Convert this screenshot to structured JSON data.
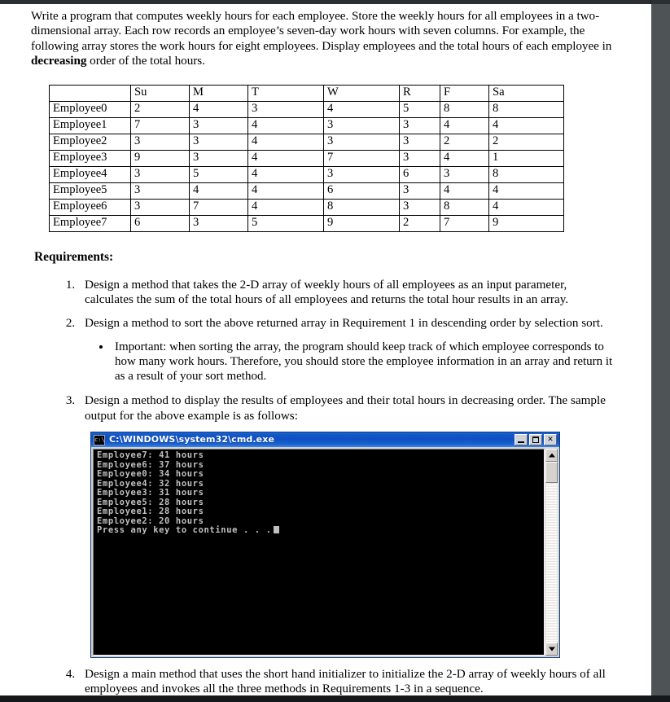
{
  "document": {
    "intro_paragraph": "Write a program that computes weekly hours for each employee.  Store the weekly hours for all employees in a two-dimensional array.  Each row records an employee’s seven-day work hours with seven columns.  For example, the following array stores the work hours for eight employees.  Display employees and the total hours of each employee in ",
    "intro_bold": "decreasing",
    "intro_tail": " order of the total hours.",
    "requirements_heading": "Requirements:"
  },
  "hours_table": {
    "corner_label": "",
    "columns": [
      "Su",
      "M",
      "T",
      "W",
      "R",
      "F",
      "Sa"
    ],
    "rows": [
      {
        "label": "Employee0",
        "values": [
          2,
          4,
          3,
          4,
          5,
          8,
          8
        ]
      },
      {
        "label": "Employee1",
        "values": [
          7,
          3,
          4,
          3,
          3,
          4,
          4
        ]
      },
      {
        "label": "Employee2",
        "values": [
          3,
          3,
          4,
          3,
          3,
          2,
          2
        ]
      },
      {
        "label": "Employee3",
        "values": [
          9,
          3,
          4,
          7,
          3,
          4,
          1
        ]
      },
      {
        "label": "Employee4",
        "values": [
          3,
          5,
          4,
          3,
          6,
          3,
          8
        ]
      },
      {
        "label": "Employee5",
        "values": [
          3,
          4,
          4,
          6,
          3,
          4,
          4
        ]
      },
      {
        "label": "Employee6",
        "values": [
          3,
          7,
          4,
          8,
          3,
          8,
          4
        ]
      },
      {
        "label": "Employee7",
        "values": [
          6,
          3,
          5,
          9,
          2,
          7,
          9
        ]
      }
    ]
  },
  "requirements": [
    {
      "text": "Design a method that takes the 2-D array of weekly hours of all employees as an input parameter, calculates the sum of the total hours of all employees and returns the total hour results in an array."
    },
    {
      "text": "Design a method to sort the above returned array in Requirement 1 in descending order by selection sort.",
      "sub_bullets": [
        "Important: when sorting the array, the program should keep track of which employee corresponds to how many work hours. Therefore, you should store the employee information in an array and return it as a result of your sort method."
      ]
    },
    {
      "text": "Design a method to display the results of employees and their total hours in decreasing order.  The sample output for the above example is as follows:"
    },
    {
      "text": "Design a main method that uses the short hand initializer to initialize the 2-D array of weekly hours of all employees and invokes all the three methods in Requirements 1-3 in a sequence."
    }
  ],
  "console_window": {
    "title": "C:\\WINDOWS\\system32\\cmd.exe",
    "icon_label": "c:\\",
    "buttons": {
      "minimize": "_",
      "maximize": "□",
      "close": "✕"
    },
    "output_lines": [
      "Employee7: 41 hours",
      "Employee6: 37 hours",
      "Employee0: 34 hours",
      "Employee4: 32 hours",
      "Employee3: 31 hours",
      "Employee5: 28 hours",
      "Employee1: 28 hours",
      "Employee2: 20 hours"
    ],
    "prompt_line": "Press any key to continue . . .",
    "scrollbar": {
      "up_arrow": "▲",
      "down_arrow": "▼"
    }
  },
  "colors": {
    "titlebar_blue": "#0f4fc0",
    "console_bg": "#000000",
    "console_text": "#c0c0c0",
    "window_chrome": "#d6d3ce",
    "page_frame": "#4e5355"
  }
}
